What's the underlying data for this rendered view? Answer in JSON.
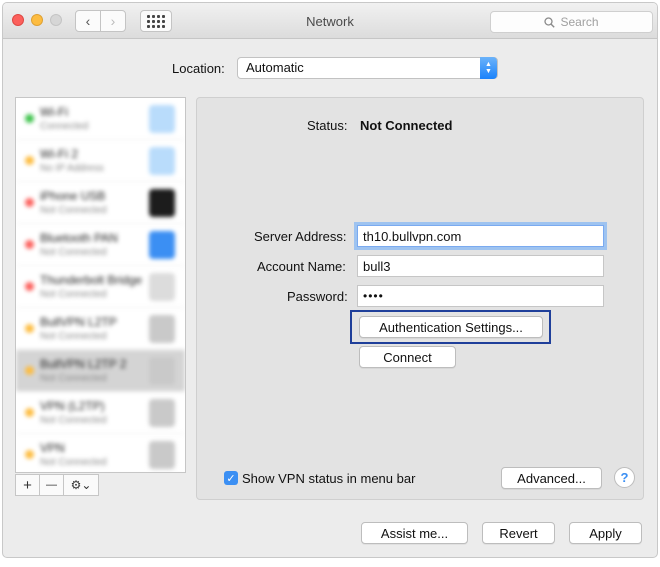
{
  "window": {
    "title": "Network",
    "search_placeholder": "Search"
  },
  "icons": {
    "back": "‹",
    "forward": "›",
    "add": "+",
    "remove": "—",
    "gear": "⚙⌄",
    "check": "✓",
    "help": "?",
    "stepper_up": "▲",
    "stepper_down": "▼"
  },
  "location": {
    "label": "Location:",
    "value": "Automatic"
  },
  "sidebar": {
    "services": [
      {
        "name": "Wi-Fi",
        "sub": "Connected",
        "status_color": "#3cc24a",
        "icon": "wifi-icon"
      },
      {
        "name": "Wi-Fi 2",
        "sub": "No IP Address",
        "status_color": "#fdbc40",
        "icon": "wifi-icon"
      },
      {
        "name": "iPhone USB",
        "sub": "Not Connected",
        "status_color": "#fc605c",
        "icon": "phone-icon"
      },
      {
        "name": "Bluetooth PAN",
        "sub": "Not Connected",
        "status_color": "#fc605c",
        "icon": "bluetooth-icon"
      },
      {
        "name": "Thunderbolt Bridge",
        "sub": "Not Connected",
        "status_color": "#fc605c",
        "icon": "bridge-icon"
      },
      {
        "name": "BullVPN L2TP",
        "sub": "Not Connected",
        "status_color": "#fdbc40",
        "icon": "lock-icon"
      },
      {
        "name": "BullVPN L2TP 2",
        "sub": "Not Connected",
        "status_color": "#fdbc40",
        "icon": "lock-icon"
      },
      {
        "name": "VPN (L2TP)",
        "sub": "Not Connected",
        "status_color": "#fdbc40",
        "icon": "lock-icon"
      },
      {
        "name": "VPN",
        "sub": "Not Connected",
        "status_color": "#fdbc40",
        "icon": "lock-icon"
      }
    ]
  },
  "detail": {
    "status_label": "Status:",
    "status_value": "Not Connected",
    "server_label": "Server Address:",
    "server_value": "th10.bullvpn.com",
    "account_label": "Account Name:",
    "account_value": "bull3",
    "password_label": "Password:",
    "password_value": "••••",
    "auth_button": "Authentication Settings...",
    "connect_button": "Connect",
    "show_status_label": "Show VPN status in menu bar",
    "show_status_checked": true,
    "advanced_button": "Advanced...",
    "help_button": "?"
  },
  "footer": {
    "assist_button": "Assist me...",
    "revert_button": "Revert",
    "apply_button": "Apply"
  },
  "colors": {
    "accent": "#1a82fb",
    "highlight_box": "#1f3f9a"
  }
}
